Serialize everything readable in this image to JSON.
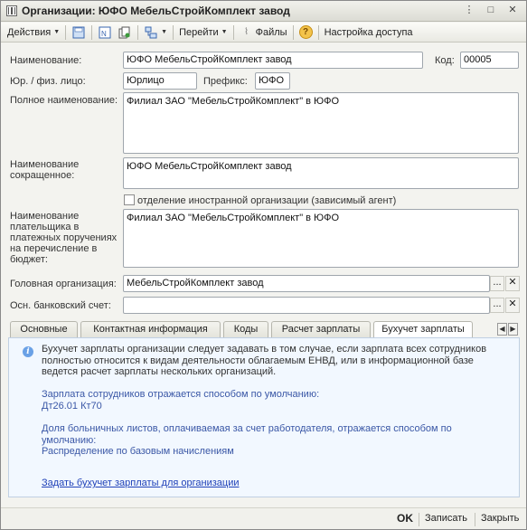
{
  "window": {
    "title": "Организации: ЮФО МебельСтройКомплект завод",
    "controls": [
      "⋮",
      "□",
      "✕"
    ]
  },
  "toolbar": {
    "actions_label": "Действия",
    "goto_label": "Перейти",
    "files_label": "Файлы",
    "help_label": "?",
    "access_label": "Настройка доступа"
  },
  "form": {
    "name_label": "Наименование:",
    "name_value": "ЮФО МебельСтройКомплект завод",
    "code_label": "Код:",
    "code_value": "00005",
    "entity_label": "Юр. / физ. лицо:",
    "entity_value": "Юрлицо",
    "prefix_label": "Префикс:",
    "prefix_value": "ЮФО",
    "full_name_label": "Полное наименование:",
    "full_name_value": "Филиал ЗАО \"МебельСтройКомплект\" в ЮФО",
    "short_name_label": "Наименование сокращенное:",
    "short_name_value": "ЮФО МебельСтройКомплект завод",
    "foreign_label": "отделение иностранной организации (зависимый агент)",
    "payer_label": "Наименование плательщика в платежных поручениях на перечисление в бюджет:",
    "payer_value": "Филиал ЗАО \"МебельСтройКомплект\" в ЮФО",
    "head_org_label": "Головная организация:",
    "head_org_value": "МебельСтройКомплект завод",
    "bank_label": "Осн. банковский счет:",
    "bank_value": "",
    "select_btn": "...",
    "clear_btn": "✕"
  },
  "tabs": [
    "Основные",
    "Контактная информация",
    "Коды",
    "Расчет зарплаты",
    "Бухучет зарплаты"
  ],
  "active_tab": "Бухучет зарплаты",
  "panel": {
    "info_icon_text": "i",
    "intro": "Бухучет зарплаты организации следует задавать в том случае, если зарплата всех сотрудников полностью относится к видам деятельности облагаемым ЕНВД, или в информационной базе ведется расчет зарплаты нескольких организаций.",
    "default_label": "Зарплата сотрудников отражается способом по умолчанию:",
    "default_value": "Дт26.01 Кт70",
    "sick_label": "Доля больничных листов, оплачиваемая за счет работодателя, отражается способом по умолчанию:",
    "sick_value": "Распределение по базовым начислениям",
    "link_label": "Задать бухучет зарплаты для организации"
  },
  "footer": {
    "ok_label": "OK",
    "save_label": "Записать",
    "close_label": "Закрыть"
  }
}
